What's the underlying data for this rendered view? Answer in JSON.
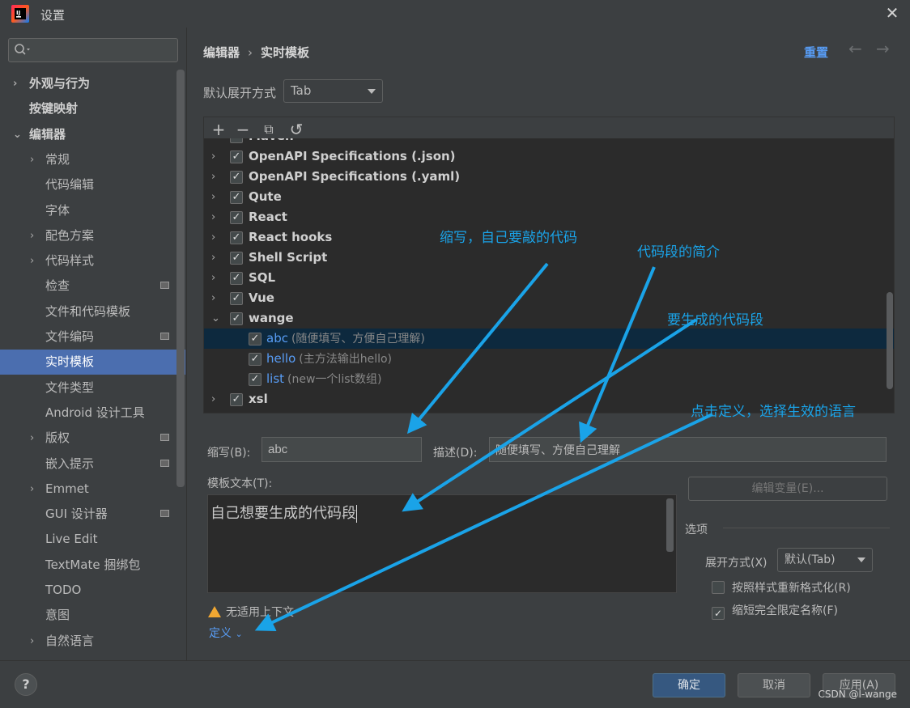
{
  "window": {
    "title": "设置",
    "close_icon": "close-icon",
    "logo": "intellij-logo"
  },
  "search": {
    "placeholder": "",
    "value": ""
  },
  "sidebar": {
    "items": [
      {
        "label": "外观与行为",
        "level": 0,
        "arrow": "›",
        "selected": false,
        "badge": false
      },
      {
        "label": "按键映射",
        "level": 0,
        "arrow": "",
        "selected": false,
        "badge": false
      },
      {
        "label": "编辑器",
        "level": 0,
        "arrow": "⌄",
        "selected": false,
        "badge": false
      },
      {
        "label": "常规",
        "level": 1,
        "arrow": "›",
        "selected": false,
        "badge": false
      },
      {
        "label": "代码编辑",
        "level": 1,
        "arrow": "",
        "selected": false,
        "badge": false
      },
      {
        "label": "字体",
        "level": 1,
        "arrow": "",
        "selected": false,
        "badge": false
      },
      {
        "label": "配色方案",
        "level": 1,
        "arrow": "›",
        "selected": false,
        "badge": false
      },
      {
        "label": "代码样式",
        "level": 1,
        "arrow": "›",
        "selected": false,
        "badge": false
      },
      {
        "label": "检查",
        "level": 1,
        "arrow": "",
        "selected": false,
        "badge": true
      },
      {
        "label": "文件和代码模板",
        "level": 1,
        "arrow": "",
        "selected": false,
        "badge": false
      },
      {
        "label": "文件编码",
        "level": 1,
        "arrow": "",
        "selected": false,
        "badge": true
      },
      {
        "label": "实时模板",
        "level": 1,
        "arrow": "",
        "selected": true,
        "badge": false
      },
      {
        "label": "文件类型",
        "level": 1,
        "arrow": "",
        "selected": false,
        "badge": false
      },
      {
        "label": "Android 设计工具",
        "level": 1,
        "arrow": "",
        "selected": false,
        "badge": false
      },
      {
        "label": "版权",
        "level": 1,
        "arrow": "›",
        "selected": false,
        "badge": true
      },
      {
        "label": "嵌入提示",
        "level": 1,
        "arrow": "",
        "selected": false,
        "badge": true
      },
      {
        "label": "Emmet",
        "level": 1,
        "arrow": "›",
        "selected": false,
        "badge": false
      },
      {
        "label": "GUI 设计器",
        "level": 1,
        "arrow": "",
        "selected": false,
        "badge": true
      },
      {
        "label": "Live Edit",
        "level": 1,
        "arrow": "",
        "selected": false,
        "badge": false
      },
      {
        "label": "TextMate 捆绑包",
        "level": 1,
        "arrow": "",
        "selected": false,
        "badge": false
      },
      {
        "label": "TODO",
        "level": 1,
        "arrow": "",
        "selected": false,
        "badge": false
      },
      {
        "label": "意图",
        "level": 1,
        "arrow": "",
        "selected": false,
        "badge": false
      },
      {
        "label": "自然语言",
        "level": 1,
        "arrow": "›",
        "selected": false,
        "badge": false
      }
    ]
  },
  "header": {
    "breadcrumb": [
      "编辑器",
      "实时模板"
    ],
    "breadcrumb_sep": "›",
    "reset_label": "重置",
    "back_glyph": "←",
    "forward_glyph": "→"
  },
  "default_expand": {
    "label": "默认展开方式",
    "value": "Tab"
  },
  "toolbar": {
    "add": "+",
    "remove": "−",
    "copy": "⧉",
    "restore": "↺"
  },
  "tree": {
    "rows": [
      {
        "kind": "grp",
        "label": "Maven",
        "checked": true,
        "expanded": false,
        "partial": true
      },
      {
        "kind": "grp",
        "label": "OpenAPI Specifications (.json)",
        "checked": true,
        "expanded": false
      },
      {
        "kind": "grp",
        "label": "OpenAPI Specifications (.yaml)",
        "checked": true,
        "expanded": false
      },
      {
        "kind": "grp",
        "label": "Qute",
        "checked": true,
        "expanded": false
      },
      {
        "kind": "grp",
        "label": "React",
        "checked": true,
        "expanded": false
      },
      {
        "kind": "grp",
        "label": "React hooks",
        "checked": true,
        "expanded": false
      },
      {
        "kind": "grp",
        "label": "Shell Script",
        "checked": true,
        "expanded": false
      },
      {
        "kind": "grp",
        "label": "SQL",
        "checked": true,
        "expanded": false
      },
      {
        "kind": "grp",
        "label": "Vue",
        "checked": true,
        "expanded": false
      },
      {
        "kind": "grp",
        "label": "wange",
        "checked": true,
        "expanded": true
      },
      {
        "kind": "child",
        "abbr": "abc",
        "desc": "(随便填写、方便自己理解)",
        "checked": true,
        "selected": true
      },
      {
        "kind": "child",
        "abbr": "hello",
        "desc": "(主方法输出hello)",
        "checked": true
      },
      {
        "kind": "child",
        "abbr": "list",
        "desc": "(new一个list数组)",
        "checked": true
      },
      {
        "kind": "grp",
        "label": "xsl",
        "checked": true,
        "expanded": false
      }
    ]
  },
  "editor": {
    "abbr_label": "缩写(B):",
    "abbr_value": "abc",
    "desc_label": "描述(D):",
    "desc_value": "随便填写、方便自己理解",
    "template_label": "模板文本(T):",
    "template_text": "自己想要生成的代码段",
    "warning_text": "无适用上下文",
    "define_label": "定义",
    "edit_vars_label": "编辑变量(E)..."
  },
  "options": {
    "title": "选项",
    "expand_label": "展开方式(X)",
    "expand_value": "默认(Tab)",
    "reformat_label": "按照样式重新格式化(R)",
    "reformat_checked": false,
    "shorten_label": "缩短完全限定名称(F)",
    "shorten_checked": true
  },
  "footer": {
    "help": "?",
    "ok": "确定",
    "cancel": "取消",
    "apply": "应用(A)",
    "watermark": "CSDN @l-wange"
  },
  "annotations": {
    "color": "#1aa3e8",
    "abbr_note": "缩写，自己要敲的代码",
    "desc_note": "代码段的简介",
    "code_note": "要生成的代码段",
    "define_note": "点击定义，选择生效的语言"
  },
  "colors": {
    "background": "#3c3f41",
    "selection": "#4b6eaf",
    "tree_selection": "#0d293e",
    "link": "#589df6",
    "ok_button": "#365880"
  }
}
